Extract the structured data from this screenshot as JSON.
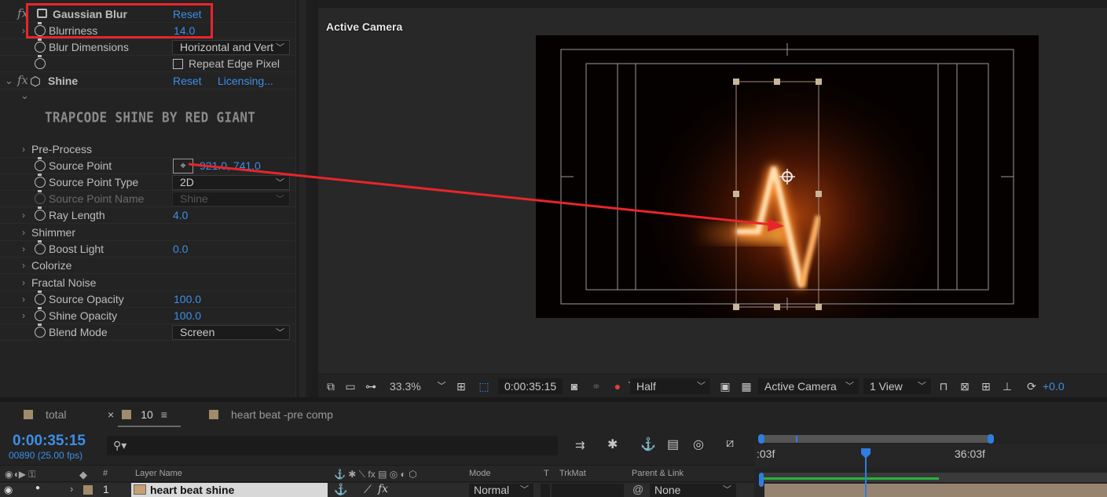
{
  "effects_panel": {
    "gaussian_blur": {
      "name": "Gaussian Blur",
      "reset": "Reset",
      "blurriness_label": "Blurriness",
      "blurriness_value": "14.0",
      "blur_dimensions_label": "Blur Dimensions",
      "blur_dimensions_value": "Horizontal and Vert",
      "repeat_edge_label": "Repeat Edge Pixel"
    },
    "shine": {
      "name": "Shine",
      "reset": "Reset",
      "licensing": "Licensing...",
      "logo_text": "TRAPCODE SHINE BY RED GIANT",
      "params": {
        "pre_process": "Pre-Process",
        "source_point_label": "Source Point",
        "source_point_value": "921.0, 741.0",
        "source_point_type_label": "Source Point Type",
        "source_point_type_value": "2D",
        "source_point_name_label": "Source Point Name",
        "source_point_name_value": "Shine",
        "ray_length_label": "Ray Length",
        "ray_length_value": "4.0",
        "shimmer": "Shimmer",
        "boost_light_label": "Boost Light",
        "boost_light_value": "0.0",
        "colorize": "Colorize",
        "fractal_noise": "Fractal Noise",
        "source_opacity_label": "Source Opacity",
        "source_opacity_value": "100.0",
        "shine_opacity_label": "Shine Opacity",
        "shine_opacity_value": "100.0",
        "blend_mode_label": "Blend Mode",
        "blend_mode_value": "Screen"
      }
    }
  },
  "viewer": {
    "camera_label": "Active Camera",
    "toolbar": {
      "zoom": "33.3%",
      "timecode": "0:00:35:15",
      "resolution": "Half",
      "camera": "Active Camera",
      "views": "1 View",
      "exposure": "+0.0"
    }
  },
  "timeline": {
    "tabs": [
      "total",
      "10",
      "heart beat -pre comp"
    ],
    "timecode": "0:00:35:15",
    "fps": "00890 (25.00 fps)",
    "columns": {
      "num": "#",
      "layer_name": "Layer Name",
      "mode": "Mode",
      "t": "T",
      "trkmat": "TrkMat",
      "parent": "Parent & Link"
    },
    "layer": {
      "index": "1",
      "name": "heart beat shine",
      "mode": "Normal",
      "parent": "None"
    },
    "ruler": {
      "left_label": ":03f",
      "right_label": "36:03f"
    }
  },
  "colors": {
    "accent_blue": "#3c8fe6",
    "annotation_red": "#e8252b"
  }
}
